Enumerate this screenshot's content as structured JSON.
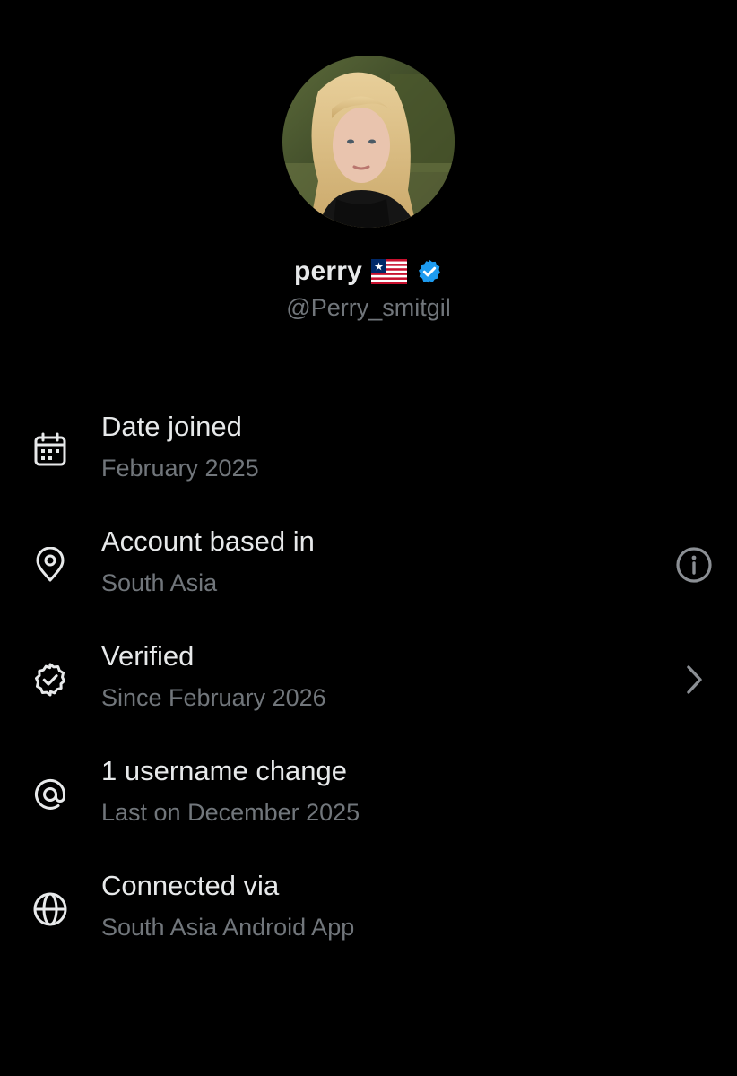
{
  "profile": {
    "display_name": "perry",
    "handle": "@Perry_smitgil",
    "flag_icon": "liberia-flag-icon",
    "verified_icon": "verified-badge-icon",
    "verified_color": "#1d9bf0"
  },
  "info_rows": [
    {
      "icon": "calendar-icon",
      "title": "Date joined",
      "subtitle": "February 2025"
    },
    {
      "icon": "location-pin-icon",
      "title": "Account based in",
      "subtitle": "South Asia",
      "action_icon": "info-icon"
    },
    {
      "icon": "verified-outline-icon",
      "title": "Verified",
      "subtitle": "Since February 2026",
      "action_icon": "chevron-right-icon"
    },
    {
      "icon": "at-sign-icon",
      "title": "1 username change",
      "subtitle": "Last on December 2025"
    },
    {
      "icon": "globe-icon",
      "title": "Connected via",
      "subtitle": "South Asia Android App"
    }
  ],
  "colors": {
    "background": "#000000",
    "primary_text": "#e7e9ea",
    "secondary_text": "#71767b"
  }
}
